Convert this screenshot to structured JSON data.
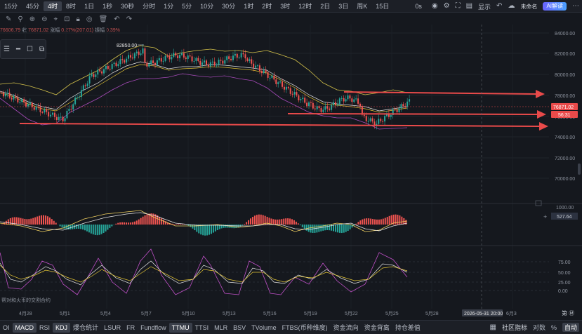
{
  "timeframes": [
    "15分",
    "45分",
    "4时",
    "8时",
    "1日",
    "1秒",
    "30秒",
    "分时",
    "1分",
    "5分",
    "10分",
    "30分",
    "1时",
    "2时",
    "3时",
    "12时",
    "2日",
    "3日",
    "周K",
    "15日"
  ],
  "active_timeframe_index": 2,
  "top_right": {
    "seconds": "0s",
    "display_label": "显示",
    "layout_name": "未命名",
    "ai_label": "AI解读"
  },
  "info_line": {
    "prefix": "76606.79",
    "close_label": "收",
    "close_value": "76871.02",
    "change_label": "涨幅",
    "change_value": "0.27%(207.01)",
    "amp_label": "振幅",
    "amp_value": "0.39%"
  },
  "price_axis": [
    "84000.00",
    "82000.00",
    "80000.00",
    "78000.00",
    "76000.00",
    "74000.00",
    "72000.00",
    "70000.00"
  ],
  "current_price": "76871.02",
  "countdown": "56:31",
  "high_label": "82850.00",
  "macd_axis": {
    "top": "1000.00",
    "value": "527.64"
  },
  "kdj_axis": [
    "75.00",
    "50.00",
    "25.00",
    "0.00"
  ],
  "date_axis": [
    "4月28",
    "5月1",
    "5月4",
    "5月7",
    "5月10",
    "5月13",
    "5月16",
    "5月19",
    "5月22",
    "5月25",
    "5月28",
    "6月3"
  ],
  "crosshair_date": "2026-05-31 20:00",
  "axis_settings": "第 Ⓜ",
  "kdj_caption": "帮对和火币的交割合约",
  "tabs": [
    "OI",
    "MACD",
    "RSI",
    "KDJ",
    "爆仓统计",
    "LSUR",
    "FR",
    "Fundflow",
    "TTMU",
    "TTSI",
    "MLR",
    "BSV",
    "TVolume",
    "FTBS(币种维度)",
    "资金流向",
    "资金背离",
    "持仓差值"
  ],
  "active_tabs": [
    "MACD",
    "KDJ",
    "TTMU"
  ],
  "tabs_right": {
    "community": "社区指标",
    "compare": "对数",
    "percent": "%",
    "auto": "自动"
  },
  "colors": {
    "up": "#26a69a",
    "down": "#ef5350",
    "bg": "#15181e",
    "arrow": "#e94a4a",
    "price_tag": "#e94a4a"
  }
}
